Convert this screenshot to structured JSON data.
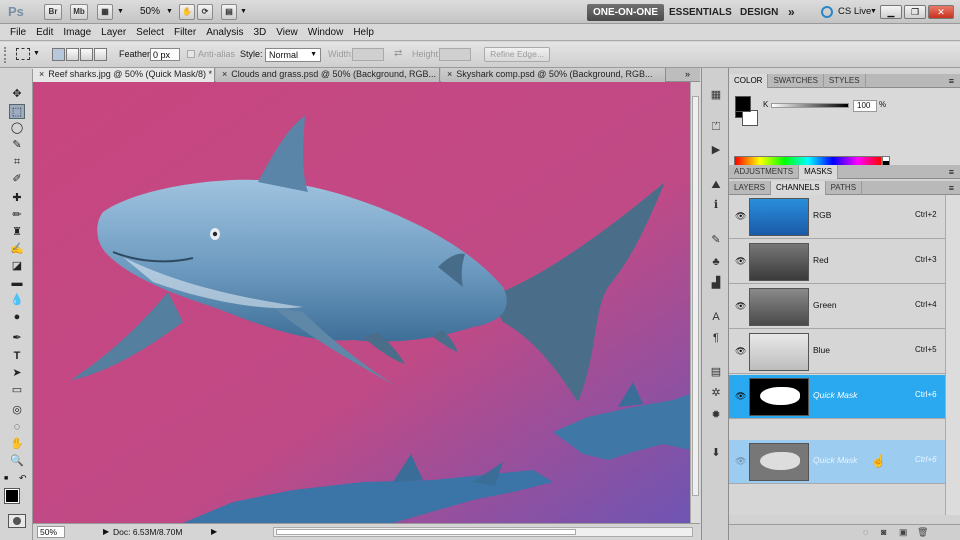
{
  "appbar": {
    "logo": "Ps",
    "bridge": "Br",
    "minibridge": "Mb",
    "zoom": "50%",
    "workspaces": [
      "ONE-ON-ONE",
      "ESSENTIALS",
      "DESIGN"
    ],
    "more": "»",
    "cslive": "CS Live"
  },
  "menu": [
    "File",
    "Edit",
    "Image",
    "Layer",
    "Select",
    "Filter",
    "Analysis",
    "3D",
    "View",
    "Window",
    "Help"
  ],
  "options": {
    "feather_label": "Feather:",
    "feather_value": "0 px",
    "antialias_label": "Anti-alias",
    "style_label": "Style:",
    "style_value": "Normal",
    "width_label": "Width:",
    "height_label": "Height:",
    "refine_label": "Refine Edge..."
  },
  "tabs": [
    {
      "label": "Reef sharks.jpg @ 50% (Quick Mask/8) *"
    },
    {
      "label": "Clouds and grass.psd @ 50% (Background, RGB..."
    },
    {
      "label": "Skyshark comp.psd @ 50% (Background, RGB..."
    }
  ],
  "status": {
    "zoom": "50%",
    "doc": "Doc: 6.53M/8.70M"
  },
  "color_panel": {
    "tabs": [
      "COLOR",
      "SWATCHES",
      "STYLES"
    ],
    "k_label": "K",
    "k_value": "100",
    "pct": "%"
  },
  "adjust_panel": {
    "tabs": [
      "ADJUSTMENTS",
      "MASKS"
    ]
  },
  "layers_panel": {
    "tabs": [
      "LAYERS",
      "CHANNELS",
      "PATHS"
    ]
  },
  "channels": [
    {
      "name": "RGB",
      "shortcut": "Ctrl+2"
    },
    {
      "name": "Red",
      "shortcut": "Ctrl+3"
    },
    {
      "name": "Green",
      "shortcut": "Ctrl+4"
    },
    {
      "name": "Blue",
      "shortcut": "Ctrl+5"
    },
    {
      "name": "Quick Mask",
      "shortcut": "Ctrl+6"
    },
    {
      "name": "Quick Mask",
      "shortcut": "Ctrl+6"
    }
  ],
  "colors": {
    "canvas_bg": "#c6457f",
    "highlight": "#2aa8f0",
    "shark": "#6f9bbd"
  }
}
